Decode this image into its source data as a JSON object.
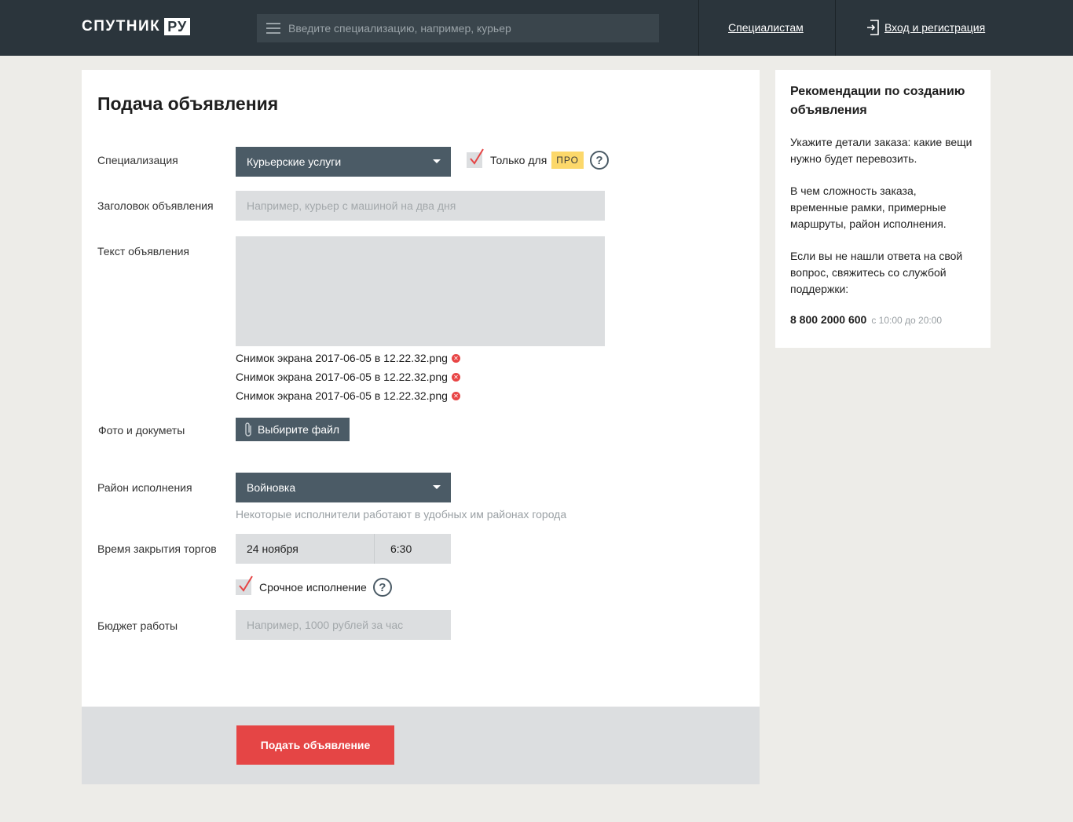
{
  "header": {
    "logo_text": "СПУТНИК",
    "logo_badge": "РУ",
    "search_placeholder": "Введите специализацию, например, курьер",
    "specialists_link": "Специалистам",
    "login_link": "Вход и регистрация"
  },
  "form": {
    "title": "Подача объявления",
    "specialization": {
      "label": "Специализация",
      "value": "Курьерские услуги",
      "pro_only_checked": true,
      "pro_only_label": "Только для",
      "pro_badge": "ПРО",
      "help": "?"
    },
    "headline": {
      "label": "Заголовок объявления",
      "placeholder": "Например, курьер с машиной на два дня"
    },
    "text": {
      "label": "Текст объявления"
    },
    "attachments": [
      "Снимок экрана 2017-06-05 в 12.22.32.png",
      "Снимок экрана 2017-06-05 в 12.22.32.png",
      "Снимок экрана 2017-06-05 в 12.22.32.png"
    ],
    "photos": {
      "label": "Фото и докуметы",
      "button": "Выбирите файл"
    },
    "district": {
      "label": "Район исполнения",
      "value": "Войновка",
      "hint": "Некоторые исполнители работают в удобных им районах города"
    },
    "closing_time": {
      "label": "Время закрытия торгов",
      "date": "24 ноября",
      "time": "6:30"
    },
    "urgent": {
      "checked": true,
      "label": "Срочное исполнение",
      "help": "?"
    },
    "budget": {
      "label": "Бюджет работы",
      "placeholder": "Например, 1000 рублей за час"
    },
    "submit": "Подать объявление"
  },
  "sidebar": {
    "title": "Рекомендации по созданию объявления",
    "paragraphs": [
      "Укажите детали заказа: какие вещи нужно будет перевозить.",
      "В чем сложность заказа, временные рамки, примерные маршруты, район исполнения.",
      "Если вы не нашли ответа на свой вопрос, свяжитесь со службой поддержки:"
    ],
    "phone": "8 800 2000 600",
    "hours": "с 10:00 до 20:00"
  },
  "colors": {
    "header_bg": "#2b353c",
    "select_bg": "#4b5b66",
    "accent_red": "#e54545",
    "pro_badge": "#fcd86b",
    "check_red": "#e54545"
  }
}
